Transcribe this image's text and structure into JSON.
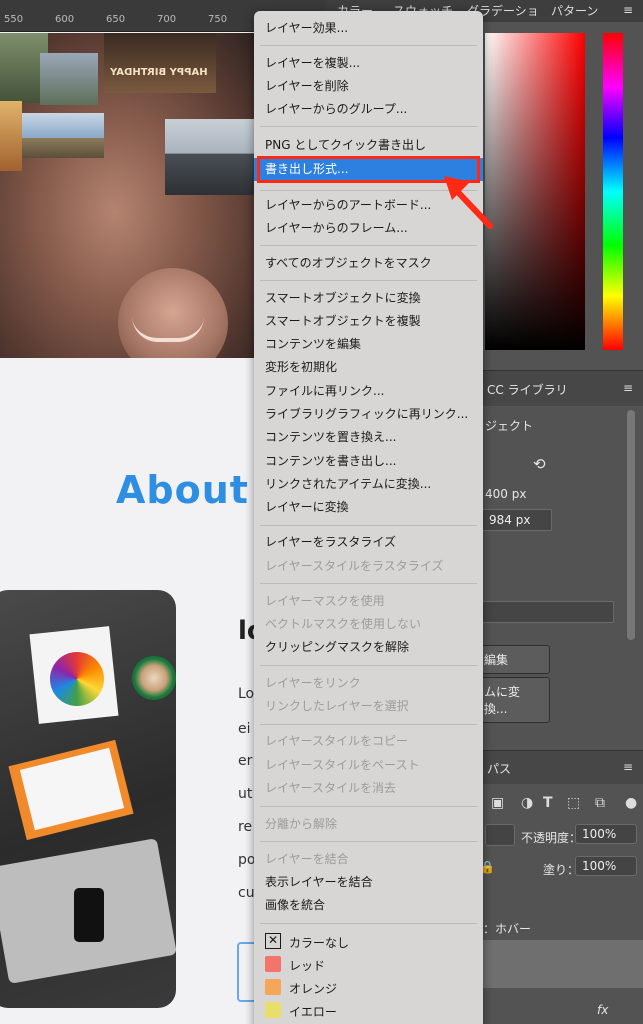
{
  "ruler": {
    "labels": [
      "550",
      "600",
      "650",
      "700",
      "750"
    ]
  },
  "canvas": {
    "cake_text": "HAPPY BIRTHDAY",
    "about_heading": "About",
    "heading_fragment": "lo",
    "paragraph_fragments": [
      "Lo",
      "ei",
      "er",
      "ut",
      "re",
      "po",
      "cu"
    ]
  },
  "panels": {
    "color_tabs": [
      "カラー",
      "スウォッチ",
      "グラデーショ",
      "パターン"
    ],
    "library_tab": "CC ライブラリ",
    "properties_object": "ジェクト",
    "width_value": "400 px",
    "height_value": "984 px",
    "edit_button": "編集",
    "convert_button": "ムに変換...",
    "paths_tab": "パス",
    "opacity_label": "不透明度：",
    "opacity_value": "100%",
    "fill_label": "塗り：",
    "fill_value": "100%",
    "layer_name": "：ホバー",
    "fx_label": "fx",
    "hamburger": "≡"
  },
  "menu": {
    "items": [
      {
        "label": "レイヤー効果...",
        "enabled": true
      },
      {
        "label": "レイヤーを複製...",
        "enabled": true
      },
      {
        "label": "レイヤーを削除",
        "enabled": true
      },
      {
        "label": "レイヤーからのグループ...",
        "enabled": true
      },
      {
        "label": "PNG としてクイック書き出し",
        "enabled": true
      },
      {
        "label": "書き出し形式...",
        "enabled": true,
        "highlighted": true
      },
      {
        "label": "レイヤーからのアートボード...",
        "enabled": true
      },
      {
        "label": "レイヤーからのフレーム...",
        "enabled": true
      },
      {
        "label": "すべてのオブジェクトをマスク",
        "enabled": true
      },
      {
        "label": "スマートオブジェクトに変換",
        "enabled": true
      },
      {
        "label": "スマートオブジェクトを複製",
        "enabled": true
      },
      {
        "label": "コンテンツを編集",
        "enabled": true
      },
      {
        "label": "変形を初期化",
        "enabled": true
      },
      {
        "label": "ファイルに再リンク...",
        "enabled": true
      },
      {
        "label": "ライブラリグラフィックに再リンク...",
        "enabled": true
      },
      {
        "label": "コンテンツを置き換え...",
        "enabled": true
      },
      {
        "label": "コンテンツを書き出し...",
        "enabled": true
      },
      {
        "label": "リンクされたアイテムに変換...",
        "enabled": true
      },
      {
        "label": "レイヤーに変換",
        "enabled": true
      },
      {
        "label": "レイヤーをラスタライズ",
        "enabled": true
      },
      {
        "label": "レイヤースタイルをラスタライズ",
        "enabled": false
      },
      {
        "label": "レイヤーマスクを使用",
        "enabled": false
      },
      {
        "label": "ベクトルマスクを使用しない",
        "enabled": false
      },
      {
        "label": "クリッピングマスクを解除",
        "enabled": true
      },
      {
        "label": "レイヤーをリンク",
        "enabled": false
      },
      {
        "label": "リンクしたレイヤーを選択",
        "enabled": false
      },
      {
        "label": "レイヤースタイルをコピー",
        "enabled": false
      },
      {
        "label": "レイヤースタイルをペースト",
        "enabled": false
      },
      {
        "label": "レイヤースタイルを消去",
        "enabled": false
      },
      {
        "label": "分離から解除",
        "enabled": false
      },
      {
        "label": "レイヤーを結合",
        "enabled": false
      },
      {
        "label": "表示レイヤーを結合",
        "enabled": true
      },
      {
        "label": "画像を統合",
        "enabled": true
      }
    ],
    "colors": [
      {
        "label": "カラーなし",
        "color": "none"
      },
      {
        "label": "レッド",
        "color": "#f2746a"
      },
      {
        "label": "オレンジ",
        "color": "#f4a65a"
      },
      {
        "label": "イエロー",
        "color": "#e8de6a"
      }
    ],
    "highlight_color": "#2d7fe0",
    "callout_color": "#ff2a14"
  }
}
